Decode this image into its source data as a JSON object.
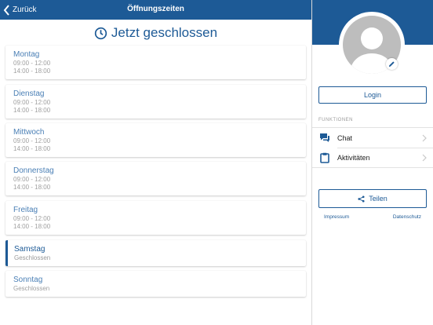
{
  "topbar": {
    "back_label": "Zurück",
    "title": "Öffnungszeiten"
  },
  "status": {
    "icon": "clock-icon",
    "text": "Jetzt geschlossen"
  },
  "days": [
    {
      "name": "Montag",
      "slots": [
        "09:00 - 12:00",
        "14:00 - 18:00"
      ]
    },
    {
      "name": "Dienstag",
      "slots": [
        "09:00 - 12:00",
        "14:00 - 18:00"
      ]
    },
    {
      "name": "Mittwoch",
      "slots": [
        "09:00 - 12:00",
        "14:00 - 18:00"
      ]
    },
    {
      "name": "Donnerstag",
      "slots": [
        "09:00 - 12:00",
        "14:00 - 18:00"
      ]
    },
    {
      "name": "Freitag",
      "slots": [
        "09:00 - 12:00",
        "14:00 - 18:00"
      ]
    },
    {
      "name": "Samstag",
      "slots": [
        "Geschlossen"
      ]
    },
    {
      "name": "Sonntag",
      "slots": [
        "Geschlossen"
      ]
    }
  ],
  "active_day": "Samstag",
  "sidebar": {
    "login_label": "Login",
    "section_label": "FUNKTIONEN",
    "menu": [
      {
        "label": "Chat",
        "icon": "chat-icon"
      },
      {
        "label": "Aktivitäten",
        "icon": "clipboard-icon"
      }
    ],
    "share_label": "Teilen",
    "footer": {
      "impressum": "Impressum",
      "datenschutz": "Datenschutz"
    }
  },
  "colors": {
    "primary": "#1d5a96",
    "accent_text": "#4a7fb5",
    "muted_text": "#a0a0a0",
    "avatar_gray": "#bdbdbd"
  }
}
